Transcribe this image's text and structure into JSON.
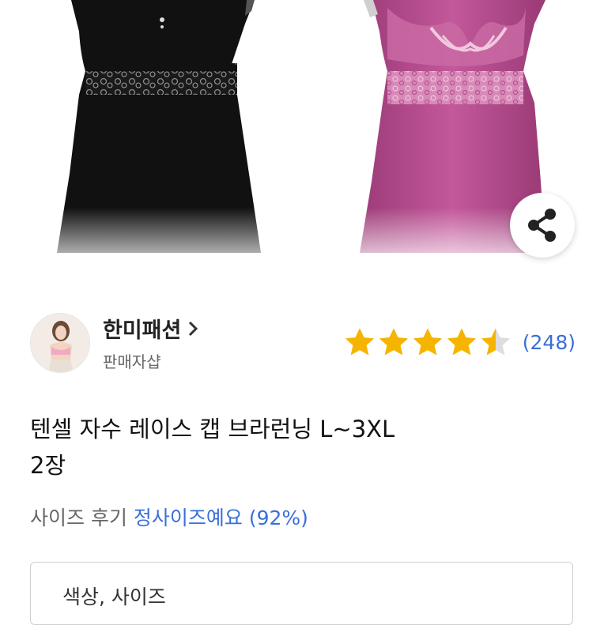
{
  "seller": {
    "name": "한미패션",
    "arrow": ">",
    "subtitle": "판매자샵"
  },
  "rating": {
    "stars": 4.5,
    "review_count": "(248)"
  },
  "product": {
    "title_line1": "텐셀 자수 레이스 캡 브라런닝 L~3XL",
    "title_line2": "2장"
  },
  "size_review": {
    "label": "사이즈 후기",
    "value": "정사이즈예요 (92%)"
  },
  "options": {
    "label": "색상, 사이즈"
  },
  "colors": {
    "accent_blue": "#3a6fd8",
    "star_gold": "#f5b400",
    "star_empty": "#dddddd",
    "product_black": "#111111",
    "product_pink": "#b24a8c"
  },
  "icons": {
    "share": "share-icon",
    "chevron": "chevron-right-icon"
  }
}
